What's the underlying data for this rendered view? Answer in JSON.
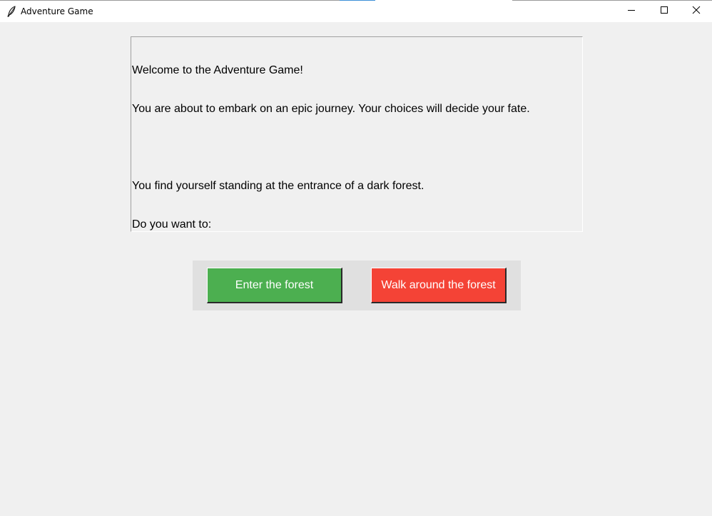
{
  "window": {
    "title": "Adventure Game",
    "icon": "feather-icon",
    "controls": [
      "minimize-icon",
      "maximize-icon",
      "close-icon"
    ]
  },
  "story": {
    "lines": [
      "Welcome to the Adventure Game!",
      "You are about to embark on an epic journey. Your choices will decide your fate.",
      "",
      "You find yourself standing at the entrance of a dark forest.",
      "Do you want to:"
    ]
  },
  "choices": {
    "enter_label": "Enter the forest",
    "walk_label": "Walk around the forest"
  },
  "colors": {
    "enter_button": "#4caf50",
    "walk_button": "#f44336",
    "background": "#f0f0f0",
    "button_frame": "#e0e0e0"
  }
}
